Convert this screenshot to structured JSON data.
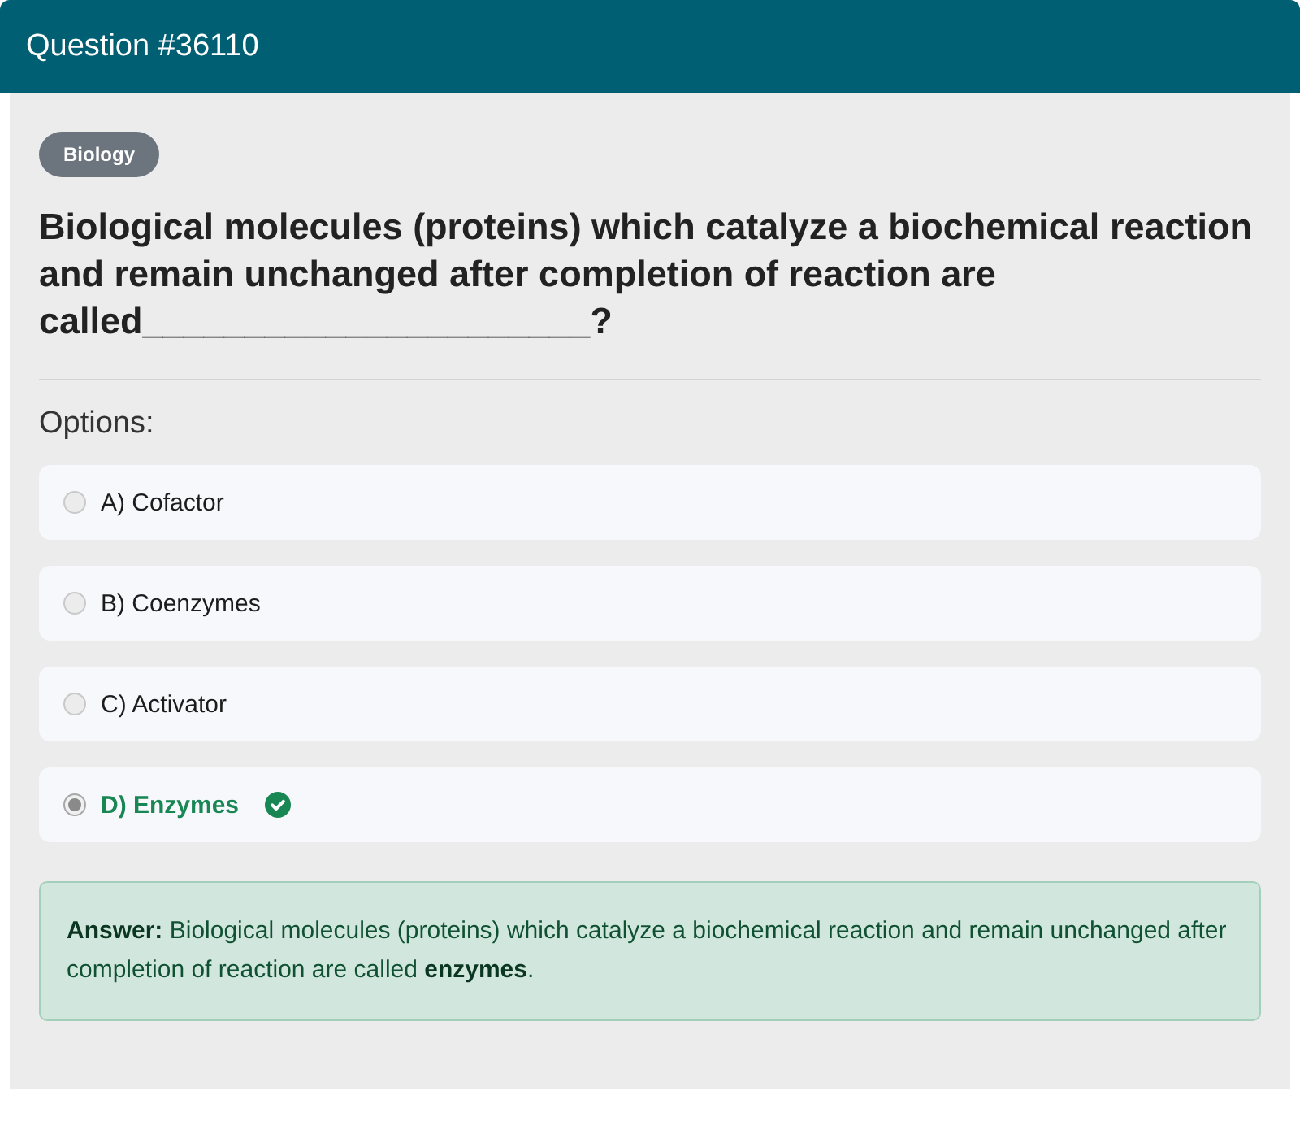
{
  "header": {
    "title": "Question #36110"
  },
  "category": "Biology",
  "question": "Biological molecules (proteins) which catalyze a biochemical reaction and remain unchanged after completion of reaction are called______________________?",
  "options_label": "Options:",
  "options": [
    {
      "label": "A) Cofactor",
      "selected": false,
      "correct": false
    },
    {
      "label": "B) Coenzymes",
      "selected": false,
      "correct": false
    },
    {
      "label": "C) Activator",
      "selected": false,
      "correct": false
    },
    {
      "label": "D) Enzymes",
      "selected": true,
      "correct": true
    }
  ],
  "answer": "**Answer:** Biological molecules (proteins) which catalyze a biochemical reaction and remain unchanged after completion of reaction are called **enzymes**."
}
